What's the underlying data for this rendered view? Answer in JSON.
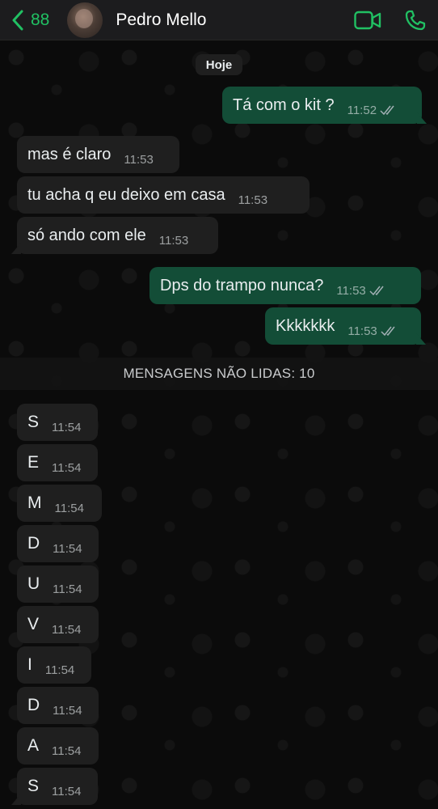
{
  "header": {
    "back_count": "88",
    "contact_name": "Pedro Mello"
  },
  "chat": {
    "date_label": "Hoje",
    "unread_label": "MENSAGENS NÃO LIDAS: 10",
    "messages": [
      {
        "text": "Tá com o kit ?",
        "time": "11:52",
        "dir": "out"
      },
      {
        "text": "mas é claro",
        "time": "11:53",
        "dir": "in"
      },
      {
        "text": "tu acha q eu deixo em casa",
        "time": "11:53",
        "dir": "in"
      },
      {
        "text": "só ando com ele",
        "time": "11:53",
        "dir": "in"
      },
      {
        "text": "Dps do trampo nunca?",
        "time": "11:53",
        "dir": "out"
      },
      {
        "text": "Kkkkkkk",
        "time": "11:53",
        "dir": "out"
      },
      {
        "text": "S",
        "time": "11:54",
        "dir": "in"
      },
      {
        "text": "E",
        "time": "11:54",
        "dir": "in"
      },
      {
        "text": "M",
        "time": "11:54",
        "dir": "in"
      },
      {
        "text": "D",
        "time": "11:54",
        "dir": "in"
      },
      {
        "text": "U",
        "time": "11:54",
        "dir": "in"
      },
      {
        "text": "V",
        "time": "11:54",
        "dir": "in"
      },
      {
        "text": "I",
        "time": "11:54",
        "dir": "in"
      },
      {
        "text": "D",
        "time": "11:54",
        "dir": "in"
      },
      {
        "text": "A",
        "time": "11:54",
        "dir": "in"
      },
      {
        "text": "S",
        "time": "11:54",
        "dir": "in"
      }
    ]
  },
  "icons": {
    "back": "chevron-left-icon",
    "video": "video-camera-icon",
    "phone": "phone-icon",
    "read_receipt": "double-check-icon"
  },
  "colors": {
    "accent": "#21c063",
    "outgoing_bubble": "#134d37",
    "incoming_bubble": "#1f1f1f",
    "background": "#0b0b0b"
  }
}
